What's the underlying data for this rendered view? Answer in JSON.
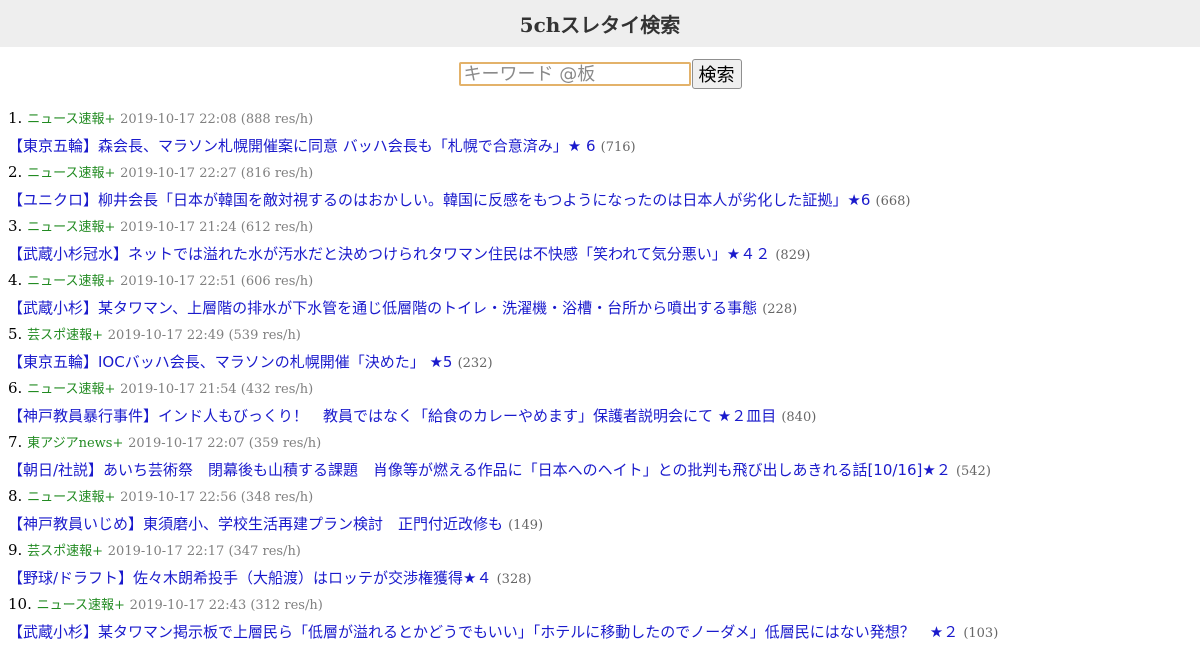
{
  "header": {
    "title": "5chスレタイ検索"
  },
  "search": {
    "placeholder": "キーワード @板",
    "button_label": "検索"
  },
  "results": [
    {
      "num": "1.",
      "board": "ニュース速報+",
      "meta": "2019-10-17 22:08 (888 res/h)",
      "title": "【東京五輪】森会長、マラソン札幌開催案に同意 バッハ会長も「札幌で合意済み」★ 6",
      "count": "(716)"
    },
    {
      "num": "2.",
      "board": "ニュース速報+",
      "meta": "2019-10-17 22:27 (816 res/h)",
      "title": "【ユニクロ】柳井会長「日本が韓国を敵対視するのはおかしい。韓国に反感をもつようになったのは日本人が劣化した証拠」★6",
      "count": "(668)"
    },
    {
      "num": "3.",
      "board": "ニュース速報+",
      "meta": "2019-10-17 21:24 (612 res/h)",
      "title": "【武蔵小杉冠水】ネットでは溢れた水が汚水だと決めつけられタワマン住民は不快感「笑われて気分悪い」★４２",
      "count": "(829)"
    },
    {
      "num": "4.",
      "board": "ニュース速報+",
      "meta": "2019-10-17 22:51 (606 res/h)",
      "title": "【武蔵小杉】某タワマン、上層階の排水が下水管を通じ低層階のトイレ・洗濯機・浴槽・台所から噴出する事態",
      "count": "(228)"
    },
    {
      "num": "5.",
      "board": "芸スポ速報+",
      "meta": "2019-10-17 22:49 (539 res/h)",
      "title": "【東京五輪】IOCバッハ会長、マラソンの札幌開催「決めた」 ★5",
      "count": "(232)"
    },
    {
      "num": "6.",
      "board": "ニュース速報+",
      "meta": "2019-10-17 21:54 (432 res/h)",
      "title": "【神戸教員暴行事件】インド人もびっくり！　教員ではなく「給食のカレーやめます」保護者説明会にて ★２皿目",
      "count": "(840)"
    },
    {
      "num": "7.",
      "board": "東アジアnews+",
      "meta": "2019-10-17 22:07 (359 res/h)",
      "title": "【朝日/社説】あいち芸術祭　閉幕後も山積する課題　肖像等が燃える作品に「日本へのヘイト」との批判も飛び出しあきれる話[10/16]★２",
      "count": "(542)"
    },
    {
      "num": "8.",
      "board": "ニュース速報+",
      "meta": "2019-10-17 22:56 (348 res/h)",
      "title": "【神戸教員いじめ】東須磨小、学校生活再建プラン検討　正門付近改修も",
      "count": "(149)"
    },
    {
      "num": "9.",
      "board": "芸スポ速報+",
      "meta": "2019-10-17 22:17 (347 res/h)",
      "title": "【野球/ドラフト】佐々木朗希投手（大船渡）はロッテが交渉権獲得★４",
      "count": "(328)"
    },
    {
      "num": "10.",
      "board": "ニュース速報+",
      "meta": "2019-10-17 22:43 (312 res/h)",
      "title": "【武蔵小杉】某タワマン掲示板で上層民ら「低層が溢れるとかどうでもいい」「ホテルに移動したのでノーダメ」低層民にはない発想？　★２",
      "count": "(103)"
    }
  ]
}
